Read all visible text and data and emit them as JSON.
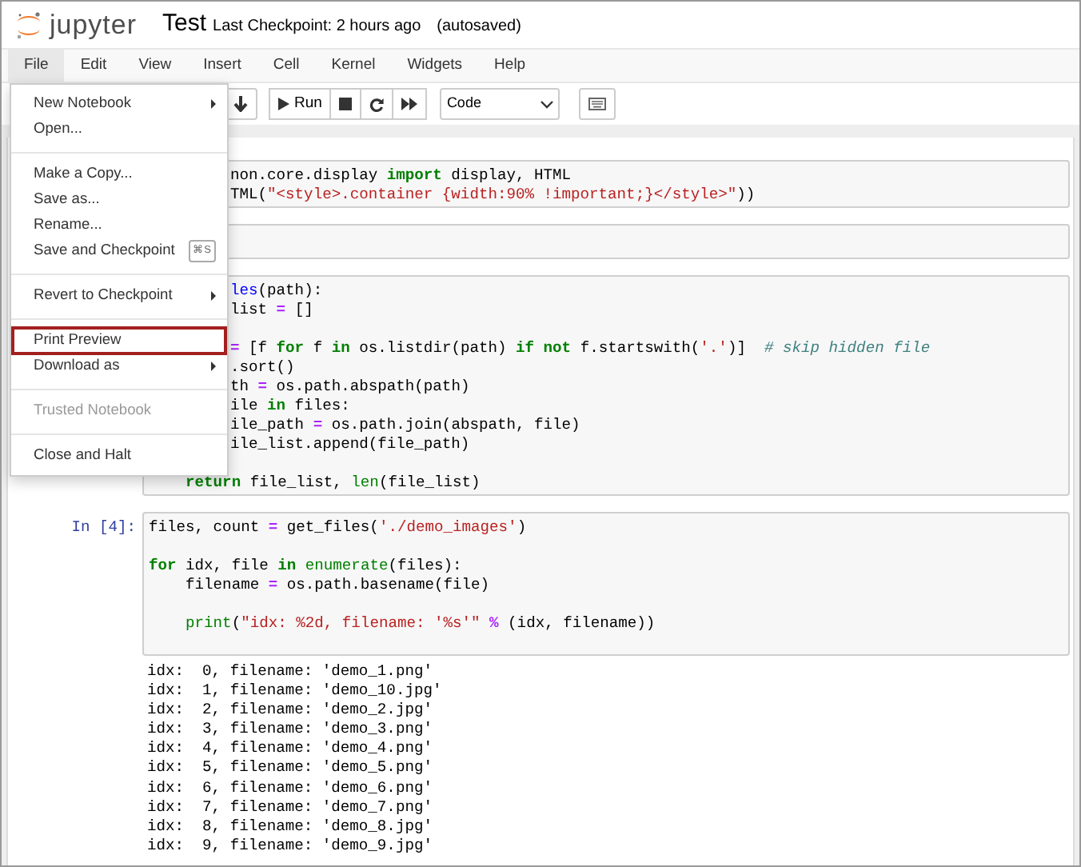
{
  "header": {
    "logo_text": "jupyter",
    "notebook_title": "Test",
    "checkpoint": "Last Checkpoint: 2 hours ago",
    "autosave": "(autosaved)"
  },
  "menubar": [
    {
      "label": "File",
      "selected": true
    },
    {
      "label": "Edit",
      "selected": false
    },
    {
      "label": "View",
      "selected": false
    },
    {
      "label": "Insert",
      "selected": false
    },
    {
      "label": "Cell",
      "selected": false
    },
    {
      "label": "Kernel",
      "selected": false
    },
    {
      "label": "Widgets",
      "selected": false
    },
    {
      "label": "Help",
      "selected": false
    }
  ],
  "toolbar": {
    "run_label": "Run",
    "cell_type": "Code"
  },
  "file_menu": [
    {
      "kind": "item",
      "label": "New Notebook",
      "submenu": true,
      "disabled": false,
      "highlighted": false
    },
    {
      "kind": "item",
      "label": "Open...",
      "submenu": false,
      "disabled": false,
      "highlighted": false
    },
    {
      "kind": "divider"
    },
    {
      "kind": "item",
      "label": "Make a Copy...",
      "submenu": false,
      "disabled": false,
      "highlighted": false
    },
    {
      "kind": "item",
      "label": "Save as...",
      "submenu": false,
      "disabled": false,
      "highlighted": false
    },
    {
      "kind": "item",
      "label": "Rename...",
      "submenu": false,
      "disabled": false,
      "highlighted": false
    },
    {
      "kind": "item",
      "label": "Save and Checkpoint",
      "shortcut": "⌘S",
      "submenu": false,
      "disabled": false,
      "highlighted": false
    },
    {
      "kind": "divider"
    },
    {
      "kind": "item",
      "label": "Revert to Checkpoint",
      "submenu": true,
      "disabled": false,
      "highlighted": false
    },
    {
      "kind": "divider"
    },
    {
      "kind": "item",
      "label": "Print Preview",
      "submenu": false,
      "disabled": false,
      "highlighted": true
    },
    {
      "kind": "item",
      "label": "Download as",
      "submenu": true,
      "disabled": false,
      "highlighted": false
    },
    {
      "kind": "divider"
    },
    {
      "kind": "item",
      "label": "Trusted Notebook",
      "submenu": false,
      "disabled": true,
      "highlighted": false
    },
    {
      "kind": "divider"
    },
    {
      "kind": "item",
      "label": "Close and Halt",
      "submenu": false,
      "disabled": false,
      "highlighted": false
    }
  ],
  "cells": [
    {
      "kind": "code",
      "lines": [
        {
          "kind": "partial",
          "segments": [
            {
              "kind": "plain",
              "text": "non.core.display "
            },
            {
              "kind": "keyword",
              "text": "import"
            },
            {
              "kind": "plain",
              "text": " display, HTML"
            }
          ]
        },
        {
          "kind": "partial",
          "segments": [
            {
              "kind": "plain",
              "text": "TML("
            },
            {
              "kind": "string",
              "text": "\"<style>.container {width:90% !important;}</style>\""
            },
            {
              "kind": "plain",
              "text": "))"
            }
          ]
        }
      ]
    },
    {
      "kind": "empty"
    },
    {
      "kind": "code",
      "lines": [
        {
          "kind": "partial",
          "segments": [
            {
              "kind": "name",
              "text": "les"
            },
            {
              "kind": "plain",
              "text": "(path):"
            }
          ]
        },
        {
          "kind": "partial",
          "segments": [
            {
              "kind": "plain",
              "text": "list "
            },
            {
              "kind": "operator",
              "text": "="
            },
            {
              "kind": "plain",
              "text": " []"
            }
          ]
        },
        {
          "kind": "blank"
        },
        {
          "kind": "partial",
          "segments": [
            {
              "kind": "operator",
              "text": "="
            },
            {
              "kind": "plain",
              "text": " [f "
            },
            {
              "kind": "keyword",
              "text": "for"
            },
            {
              "kind": "plain",
              "text": " f "
            },
            {
              "kind": "keyword",
              "text": "in"
            },
            {
              "kind": "plain",
              "text": " os.listdir(path) "
            },
            {
              "kind": "keyword",
              "text": "if not"
            },
            {
              "kind": "plain",
              "text": " f.startswith("
            },
            {
              "kind": "string",
              "text": "'.'"
            },
            {
              "kind": "plain",
              "text": ")]  "
            },
            {
              "kind": "comment",
              "text": "# skip hidden file"
            }
          ]
        },
        {
          "kind": "partial",
          "segments": [
            {
              "kind": "plain",
              "text": ".sort()"
            }
          ]
        },
        {
          "kind": "partial",
          "segments": [
            {
              "kind": "plain",
              "text": "th "
            },
            {
              "kind": "operator",
              "text": "="
            },
            {
              "kind": "plain",
              "text": " os.path.abspath(path)"
            }
          ]
        },
        {
          "kind": "partial",
          "segments": [
            {
              "kind": "plain",
              "text": "ile "
            },
            {
              "kind": "keyword",
              "text": "in"
            },
            {
              "kind": "plain",
              "text": " files:"
            }
          ]
        },
        {
          "kind": "partial",
          "segments": [
            {
              "kind": "plain",
              "text": "ile_path "
            },
            {
              "kind": "operator",
              "text": "="
            },
            {
              "kind": "plain",
              "text": " os.path.join(abspath, file)"
            }
          ]
        },
        {
          "kind": "partial",
          "segments": [
            {
              "kind": "plain",
              "text": "ile_list.append(file_path)"
            }
          ]
        },
        {
          "kind": "blank"
        },
        {
          "kind": "full",
          "segments": [
            {
              "kind": "keyword",
              "text": "    return"
            },
            {
              "kind": "plain",
              "text": " file_list, "
            },
            {
              "kind": "builtin",
              "text": "len"
            },
            {
              "kind": "plain",
              "text": "(file_list)"
            }
          ]
        }
      ]
    },
    {
      "kind": "code",
      "prompt": "In [4]:",
      "lines": [
        {
          "kind": "full",
          "segments": [
            {
              "kind": "plain",
              "text": "files, count "
            },
            {
              "kind": "operator",
              "text": "="
            },
            {
              "kind": "plain",
              "text": " get_files("
            },
            {
              "kind": "string",
              "text": "'./demo_images'"
            },
            {
              "kind": "plain",
              "text": ")"
            }
          ]
        },
        {
          "kind": "blank"
        },
        {
          "kind": "full",
          "segments": [
            {
              "kind": "keyword",
              "text": "for"
            },
            {
              "kind": "plain",
              "text": " idx, file "
            },
            {
              "kind": "keyword",
              "text": "in"
            },
            {
              "kind": "builtin",
              "text": " enumerate"
            },
            {
              "kind": "plain",
              "text": "(files):"
            }
          ]
        },
        {
          "kind": "full",
          "segments": [
            {
              "kind": "plain",
              "text": "    filename "
            },
            {
              "kind": "operator",
              "text": "="
            },
            {
              "kind": "plain",
              "text": " os.path.basename(file)"
            }
          ]
        },
        {
          "kind": "blank"
        },
        {
          "kind": "full",
          "segments": [
            {
              "kind": "builtin",
              "text": "    print"
            },
            {
              "kind": "plain",
              "text": "("
            },
            {
              "kind": "string",
              "text": "\"idx: %2d, filename: '%s'\""
            },
            {
              "kind": "operator",
              "text": " %"
            },
            {
              "kind": "plain",
              "text": " (idx, filename))"
            }
          ]
        },
        {
          "kind": "blank"
        }
      ],
      "output": [
        "idx:  0, filename: 'demo_1.png'",
        "idx:  1, filename: 'demo_10.jpg'",
        "idx:  2, filename: 'demo_2.jpg'",
        "idx:  3, filename: 'demo_3.png'",
        "idx:  4, filename: 'demo_4.png'",
        "idx:  5, filename: 'demo_5.png'",
        "idx:  6, filename: 'demo_6.png'",
        "idx:  7, filename: 'demo_7.png'",
        "idx:  8, filename: 'demo_8.jpg'",
        "idx:  9, filename: 'demo_9.jpg'"
      ]
    }
  ]
}
